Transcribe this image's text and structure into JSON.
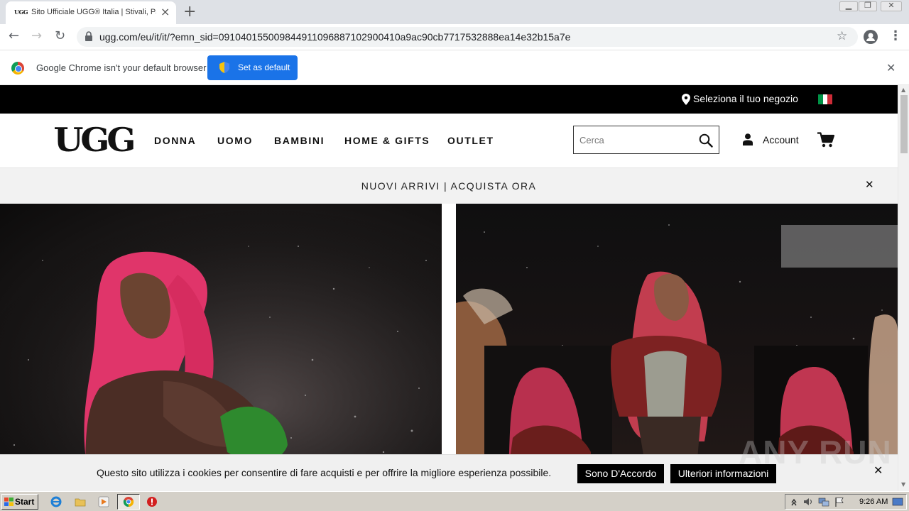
{
  "browser": {
    "tab_title": "Sito Ufficiale UGG® Italia | Stivali, Pantofole",
    "tab_favicon": "UGG",
    "tab_close": "×",
    "new_tab": "+",
    "url": "ugg.com/eu/it/it/?emn_sid=091040155009844911096887102900410a9ac90cb7717532888ea14e32b15a7e",
    "nav": {
      "back": "←",
      "forward": "→",
      "reload": "↻",
      "star": "☆",
      "menu": "⋮"
    },
    "window_controls": {
      "minimize": "▁",
      "maximize": "❐",
      "close": "✕"
    }
  },
  "infobar": {
    "message": "Google Chrome isn't your default browser",
    "button_label": "Set as default",
    "close": "✕"
  },
  "site": {
    "store_locator": "Seleziona il tuo negozio",
    "logo": "UGG",
    "nav": [
      {
        "label": "DONNA"
      },
      {
        "label": "UOMO"
      },
      {
        "label": "BAMBINI"
      },
      {
        "label": "HOME & GIFTS"
      },
      {
        "label": "OUTLET"
      }
    ],
    "search": {
      "placeholder": "Cerca"
    },
    "account_label": "Account",
    "promo": {
      "text": "NUOVI ARRIVI | ACQUISTA ORA",
      "close": "✕"
    },
    "flag_colors": [
      "#009246",
      "#ffffff",
      "#ce2b37"
    ]
  },
  "cookie_bar": {
    "text": "Questo sito utilizza i cookies per consentire di fare acquisti e per offrire la migliore esperienza possibile.",
    "accept_label": "Sono D'Accordo",
    "more_label": "Ulteriori informazioni",
    "close": "✕"
  },
  "watermark": "ANY RUN",
  "taskbar": {
    "start_label": "Start",
    "clock": "9:26 AM"
  },
  "scrollbar": {
    "up": "▲",
    "down": "▼"
  }
}
